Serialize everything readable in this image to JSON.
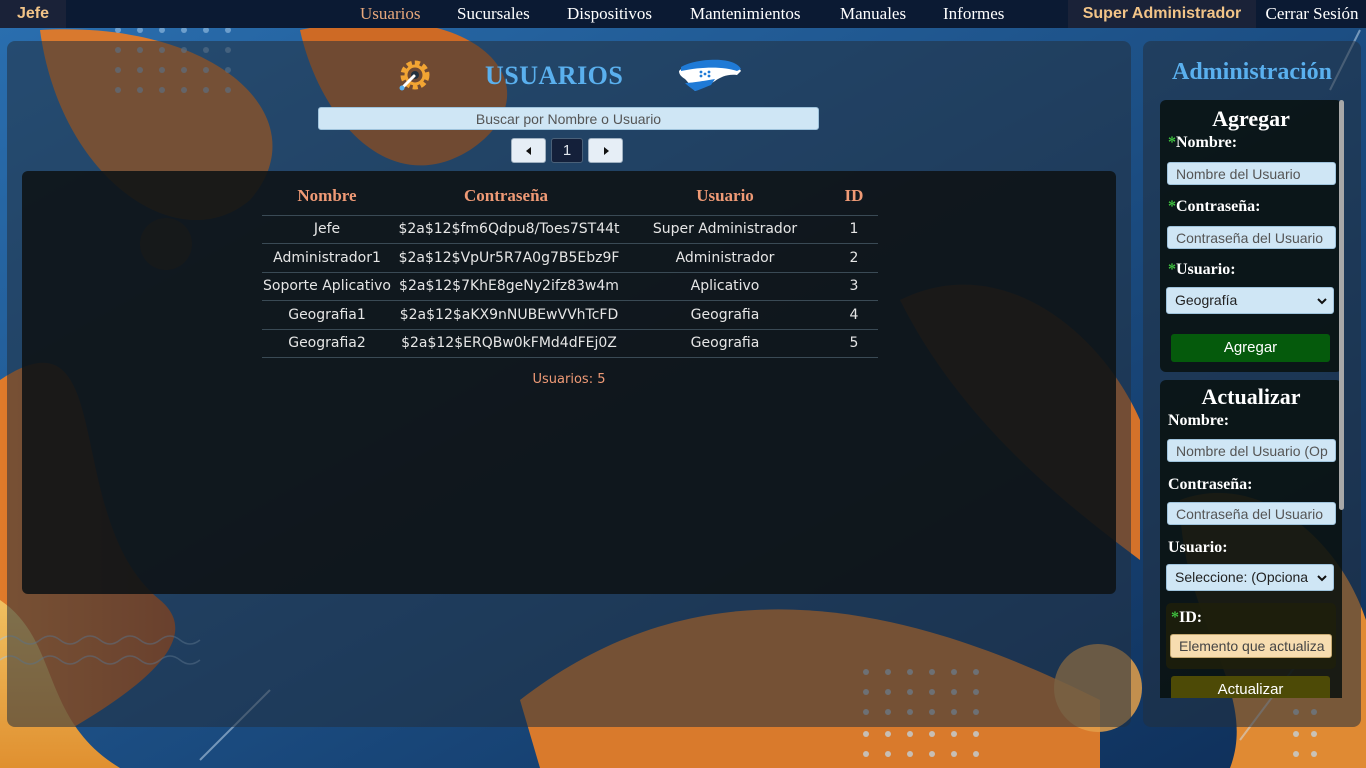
{
  "nav": {
    "brand": "Jefe",
    "links": [
      "Usuarios",
      "Sucursales",
      "Dispositivos",
      "Mantenimientos",
      "Manuales",
      "Informes"
    ],
    "active": "Usuarios",
    "role": "Super Administrador",
    "logout": "Cerrar Sesión"
  },
  "page": {
    "title": "USUARIOS",
    "search_placeholder": "Buscar por Nombre o Usuario",
    "current_page": "1"
  },
  "table": {
    "headers": [
      "Nombre",
      "Contraseña",
      "Usuario",
      "ID"
    ],
    "rows": [
      [
        "Jefe",
        "$2a$12$fm6Qdpu8/Toes7ST44t",
        "Super Administrador",
        "1"
      ],
      [
        "Administrador1",
        "$2a$12$VpUr5R7A0g7B5Ebz9F",
        "Administrador",
        "2"
      ],
      [
        "Soporte Aplicativo",
        "$2a$12$7KhE8geNy2ifz83w4m",
        "Aplicativo",
        "3"
      ],
      [
        "Geografia1",
        "$2a$12$aKX9nNUBEwVVhTcFD",
        "Geografia",
        "4"
      ],
      [
        "Geografia2",
        "$2a$12$ERQBw0kFMd4dFEj0Z",
        "Geografia",
        "5"
      ]
    ],
    "count": "Usuarios: 5"
  },
  "admin": {
    "title": "Administración",
    "add": {
      "title": "Agregar",
      "name_label": "Nombre:",
      "name_placeholder": "Nombre del Usuario",
      "password_label": "Contraseña:",
      "password_placeholder": "Contraseña del Usuario",
      "user_label": "Usuario:",
      "user_selected": "Geografía",
      "button": "Agregar"
    },
    "update": {
      "title": "Actualizar",
      "name_label": "Nombre:",
      "name_placeholder": "Nombre del Usuario (Op",
      "password_label": "Contraseña:",
      "password_placeholder": "Contraseña del Usuario",
      "user_label": "Usuario:",
      "user_selected": "Seleccione: (Opciona",
      "id_label": "ID:",
      "id_placeholder": "Elemento que actualiza",
      "button": "Actualizar"
    },
    "required_mark": "*"
  },
  "colors": {
    "accent_blue": "#5ab0ee",
    "header_salmon": "#ef9a76",
    "add_green": "#055a0c",
    "update_olive": "#4d4a06"
  }
}
